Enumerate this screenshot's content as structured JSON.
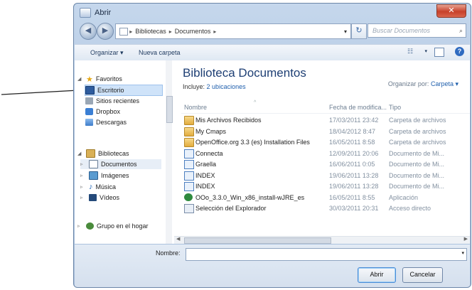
{
  "window": {
    "title": "Abrir"
  },
  "address": {
    "segments": [
      "Bibliotecas",
      "Documentos"
    ],
    "search_placeholder": "Buscar Documentos"
  },
  "toolbar": {
    "organize": "Organizar ▾",
    "new_folder": "Nueva carpeta"
  },
  "nav": {
    "favorites": "Favoritos",
    "desktop": "Escritorio",
    "recent": "Sitios recientes",
    "dropbox": "Dropbox",
    "downloads": "Descargas",
    "libraries": "Bibliotecas",
    "documents": "Documentos",
    "images": "Imágenes",
    "music": "Música",
    "videos": "Vídeos",
    "homegroup": "Grupo en el hogar"
  },
  "library": {
    "title": "Biblioteca Documentos",
    "includes_label": "Incluye:",
    "includes_link": "2 ubicaciones",
    "arrange_label": "Organizar por:",
    "arrange_value": "Carpeta ▾"
  },
  "columns": {
    "name": "Nombre",
    "date": "Fecha de modifica...",
    "type": "Tipo"
  },
  "files": [
    {
      "name": "Mis Archivos Recibidos",
      "date": "17/03/2011 23:42",
      "type": "Carpeta de archivos",
      "icon": "folder-icon"
    },
    {
      "name": "My Cmaps",
      "date": "18/04/2012 8:47",
      "type": "Carpeta de archivos",
      "icon": "folder-icon"
    },
    {
      "name": "OpenOffice.org 3.3 (es) Installation Files",
      "date": "16/05/2011 8:58",
      "type": "Carpeta de archivos",
      "icon": "folder-icon"
    },
    {
      "name": "Connecta",
      "date": "12/09/2011 20:06",
      "type": "Documento de Mi...",
      "icon": "document-icon"
    },
    {
      "name": "Graella",
      "date": "16/06/2011 0:05",
      "type": "Documento de Mi...",
      "icon": "document-icon"
    },
    {
      "name": "INDEX",
      "date": "19/06/2011 13:28",
      "type": "Documento de Mi...",
      "icon": "document-icon"
    },
    {
      "name": "INDEX",
      "date": "19/06/2011 13:28",
      "type": "Documento de Mi...",
      "icon": "document-icon"
    },
    {
      "name": "OOo_3.3.0_Win_x86_install-wJRE_es",
      "date": "16/05/2011 8:55",
      "type": "Aplicación",
      "icon": "application-icon"
    },
    {
      "name": "Selección del Explorador",
      "date": "30/03/2011 20:31",
      "type": "Acceso directo",
      "icon": "shortcut-icon"
    }
  ],
  "footer": {
    "filename_label": "Nombre:",
    "filename_value": "",
    "open_label": "Abrir",
    "cancel_label": "Cancelar"
  }
}
